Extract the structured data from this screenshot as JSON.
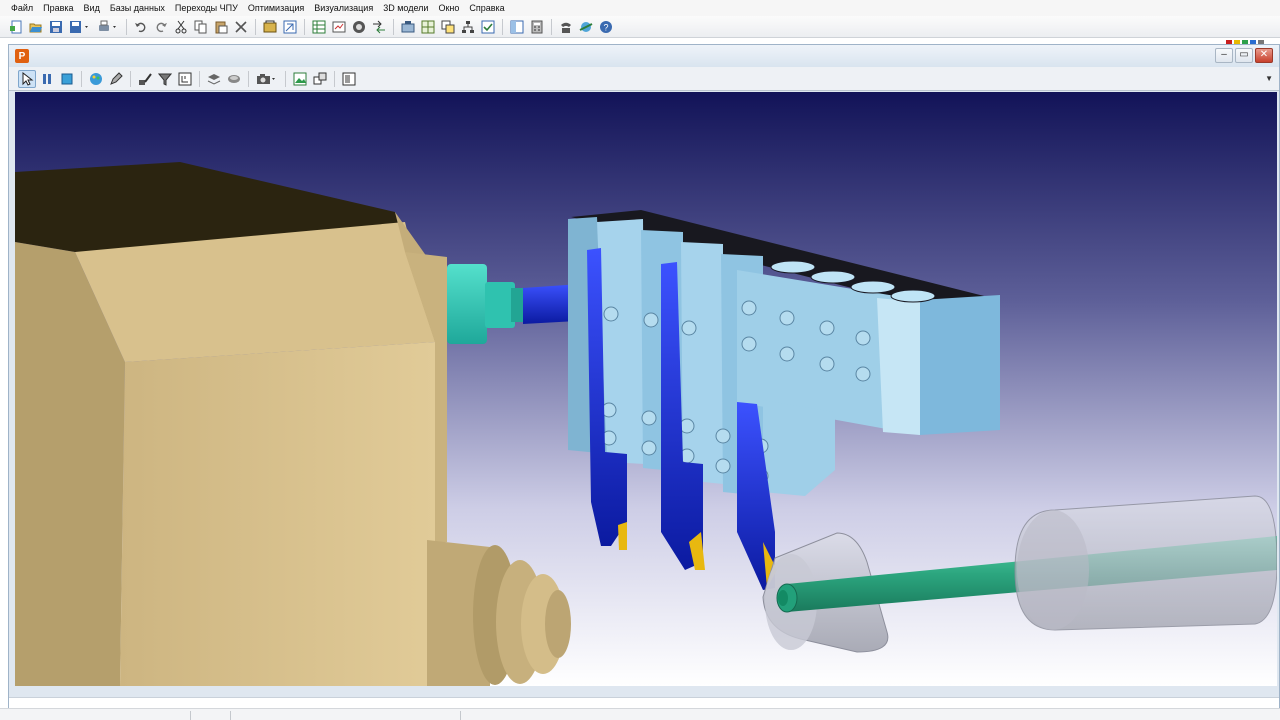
{
  "menu": [
    "Файл",
    "Правка",
    "Вид",
    "Базы данных",
    "Переходы ЧПУ",
    "Оптимизация",
    "Визуализация",
    "3D модели",
    "Окно",
    "Справка"
  ],
  "window": {
    "app_icon_letter": "P",
    "title": "",
    "buttons": {
      "minimize": "–",
      "restore": "▭",
      "close": "✕"
    }
  },
  "colors": {
    "viewport_top": "#121358",
    "viewport_bottom": "#ffffff",
    "headstock": "#d9c28f",
    "tool_block": "#8fc9e8",
    "tool_shank": "#1428c8",
    "insert": "#e8b810",
    "spindle_adapter": "#33ccbb",
    "workpiece": "#33b08a"
  },
  "icons": {
    "main_toolbar": [
      "new-icon",
      "open-icon",
      "save-icon",
      "save-as-icon",
      "print-icon",
      "undo-icon",
      "redo-icon",
      "cut-icon",
      "copy-icon",
      "paste-icon",
      "delete-icon",
      "tool-library-icon",
      "export-icon",
      "table-icon",
      "gauge-icon",
      "tree-icon",
      "transfer-icon",
      "machine-icon",
      "grid-icon",
      "copy-layout-icon",
      "hierarchy-icon",
      "check-icon",
      "panel-icon",
      "calculator-icon",
      "phone-icon",
      "network-icon",
      "help-icon"
    ],
    "view_toolbar": [
      "select-arrow-icon",
      "pause-icon",
      "stop-icon",
      "palette-icon",
      "pencil-icon",
      "fixture-icon",
      "funnel-icon",
      "measure-icon",
      "layer-icon",
      "rotate-icon",
      "camera-icon",
      "image-icon",
      "view-cube-icon",
      "settings-panel-icon"
    ]
  }
}
